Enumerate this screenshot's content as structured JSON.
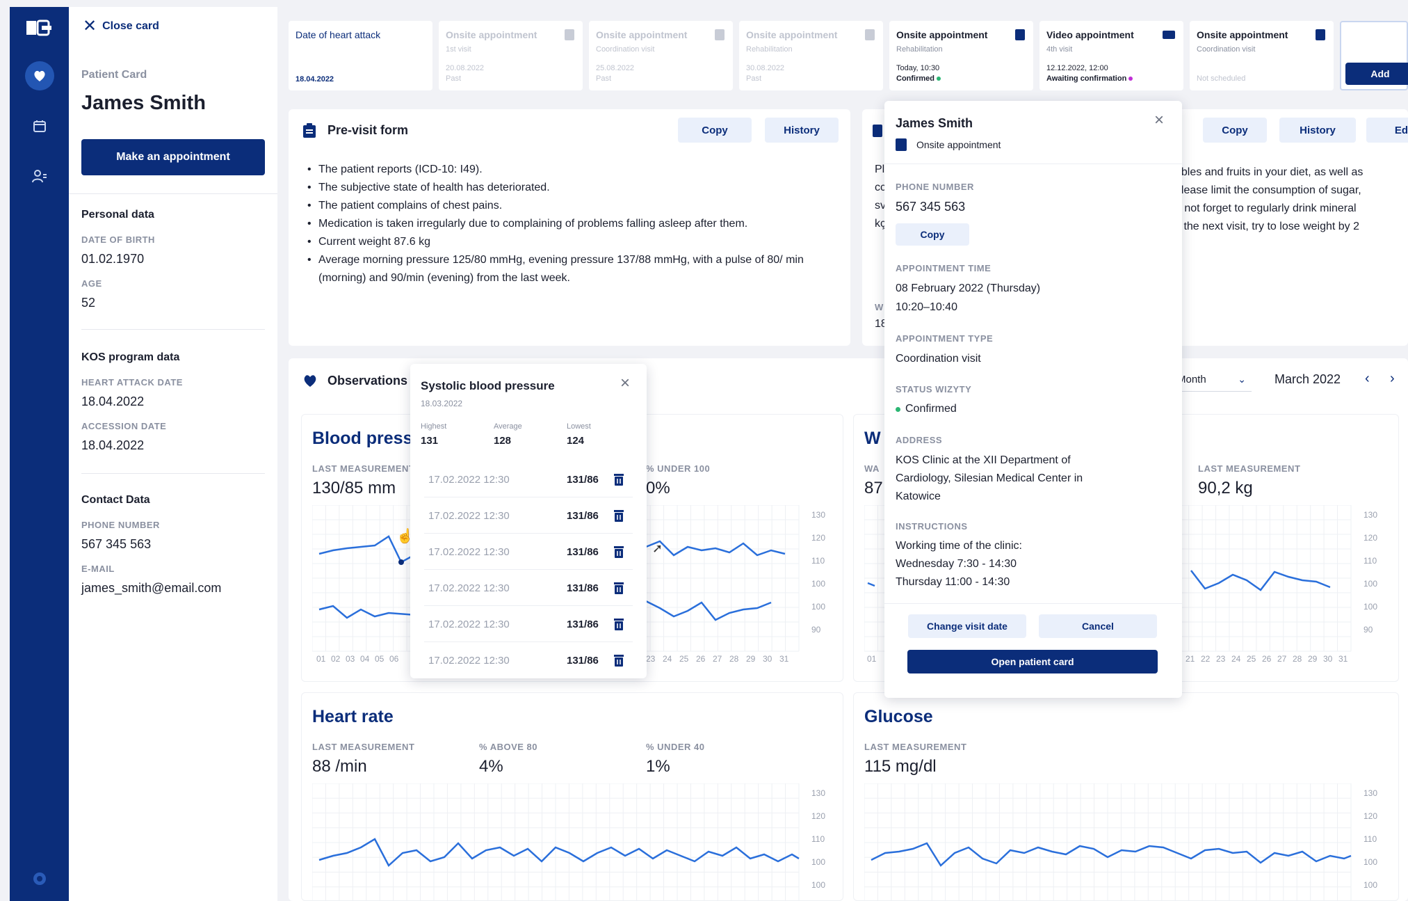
{
  "colors": {
    "brand": "#0b2d7a",
    "chart_line": "#2a6fdb",
    "confirmed": "#2bb673",
    "awaiting": "#c02fd6"
  },
  "sidebar": {
    "icons": [
      "logo-icon",
      "heart-icon",
      "calendar-icon",
      "patients-icon",
      "settings-icon"
    ]
  },
  "patient": {
    "close_label": "Close card",
    "card_label": "Patient Card",
    "name": "James Smith",
    "appointment_button": "Make an appointment",
    "personal_title": "Personal data",
    "dob_label": "DATE OF BIRTH",
    "dob": "01.02.1970",
    "age_label": "AGE",
    "age": "52",
    "kos_title": "KOS program data",
    "heart_attack_label": "HEART ATTACK DATE",
    "heart_attack": "18.04.2022",
    "accession_label": "ACCESSION DATE",
    "accession": "18.04.2022",
    "contact_title": "Contact Data",
    "phone_label": "PHONE NUMBER",
    "phone": "567 345 563",
    "email_label": "E-MAIL",
    "email": "james_smith@email.com"
  },
  "appointments": [
    {
      "title": "Date of heart attack",
      "sub": "",
      "date": "18.04.2022",
      "status": ""
    },
    {
      "title": "Onsite appointment",
      "sub": "1st visit",
      "date": "20.08.2022",
      "status": "Past"
    },
    {
      "title": "Onsite appointment",
      "sub": "Coordination visit",
      "date": "25.08.2022",
      "status": "Past"
    },
    {
      "title": "Onsite appointment",
      "sub": "Rehabilitation",
      "date": "30.08.2022",
      "status": "Past"
    },
    {
      "title": "Onsite appointment",
      "sub": "Rehabilitation",
      "date": "Today, 10:30",
      "status": "Confirmed"
    },
    {
      "title": "Video appointment",
      "sub": "4th visit",
      "date": "12.12.2022, 12:00",
      "status": "Awaiting confirmation"
    },
    {
      "title": "Onsite appointment",
      "sub": "Coordination visit",
      "date": "",
      "status": "Not scheduled"
    }
  ],
  "add_label": "Add",
  "previsit": {
    "title": "Pre-visit form",
    "copy": "Copy",
    "history": "History",
    "items": [
      "The patient reports (ICD-10: I49).",
      "The subjective state of health has deteriorated.",
      "The patient complains of chest pains.",
      "Medication is taken irregularly due to complaining of problems falling asleep after them.",
      "Current weight 87.6 kg",
      "Average morning pressure 125/80 mmHg, evening pressure 137/88 mmHg, with a pulse of 80/ min (morning) and 90/min (evening) from the last week."
    ]
  },
  "recommendation": {
    "copy": "Copy",
    "history": "History",
    "edit": "Edit",
    "fragments": [
      "Pl",
      "cc",
      "sv",
      "kç",
      "W",
      "18"
    ],
    "right_lines": [
      "ables and fruits in your diet, as well as",
      "please limit the consumption of sugar,",
      "o not forget to regularly drink mineral",
      "y the next visit, try to lose weight by 2"
    ]
  },
  "observations": {
    "title": "Observations",
    "period": "Month",
    "month": "March 2022"
  },
  "bp": {
    "title": "Blood press",
    "last_label": "LAST MEASUREMENT",
    "last": "130/85 mm",
    "under_label": "% UNDER 100",
    "under": "0%"
  },
  "weight": {
    "title": "W",
    "wa_label": "WA",
    "wa_val": "87",
    "last_label": "LAST MEASUREMENT",
    "last": "90,2 kg"
  },
  "heart": {
    "title": "Heart rate",
    "last_label": "LAST MEASUREMENT",
    "last": "88 /min",
    "above_label": "% ABOVE 80",
    "above": "4%",
    "under_label": "% UNDER 40",
    "under": "1%"
  },
  "glucose": {
    "title": "Glucose",
    "last_label": "LAST MEASUREMENT",
    "last": "115 mg/dl"
  },
  "axis": {
    "y_upper": [
      "130",
      "120",
      "110",
      "100"
    ],
    "y_lower": [
      "100",
      "90"
    ],
    "y_heart": [
      "130",
      "120",
      "110",
      "100",
      "100"
    ],
    "x_left": [
      "01",
      "02",
      "03",
      "04",
      "05",
      "06"
    ],
    "x_right": [
      "23",
      "24",
      "25",
      "26",
      "27",
      "28",
      "29",
      "30",
      "31"
    ],
    "x_weight_left": [
      "01"
    ],
    "x_weight_right": [
      "21",
      "22",
      "23",
      "24",
      "25",
      "26",
      "27",
      "28",
      "29",
      "30",
      "31"
    ]
  },
  "sbp_popup": {
    "title": "Systolic blood pressure",
    "date": "18.03.2022",
    "highest_label": "Highest",
    "highest": "131",
    "average_label": "Average",
    "average": "128",
    "lowest_label": "Lowest",
    "lowest": "124",
    "rows": [
      {
        "dt": "17.02.2022 12:30",
        "v": "131/86"
      },
      {
        "dt": "17.02.2022 12:30",
        "v": "131/86"
      },
      {
        "dt": "17.02.2022 12:30",
        "v": "131/86"
      },
      {
        "dt": "17.02.2022 12:30",
        "v": "131/86"
      },
      {
        "dt": "17.02.2022 12:30",
        "v": "131/86"
      },
      {
        "dt": "17.02.2022 12:30",
        "v": "131/86"
      }
    ]
  },
  "appt_popup": {
    "name": "James Smith",
    "type_line": "Onsite appointment",
    "phone_label": "PHONE NUMBER",
    "phone": "567 345 563",
    "copy": "Copy",
    "time_label": "APPOINTMENT TIME",
    "time_1": "08 February 2022 (Thursday)",
    "time_2": "10:20–10:40",
    "type_label": "APPOINTMENT TYPE",
    "type": "Coordination visit",
    "status_label": "STATUS WIZYTY",
    "status": "Confirmed",
    "address_label": "ADDRESS",
    "address_1": "KOS Clinic at the XII Department of",
    "address_2": "Cardiology, Silesian Medical Center in",
    "address_3": "Katowice",
    "instr_label": "INSTRUCTIONS",
    "instr_1": "Working time of the clinic:",
    "instr_2": "Wednesday 7:30 - 14:30",
    "instr_3": "Thursday 11:00 - 14:30",
    "change_btn": "Change visit date",
    "cancel_btn": "Cancel",
    "open_btn": "Open patient card"
  }
}
